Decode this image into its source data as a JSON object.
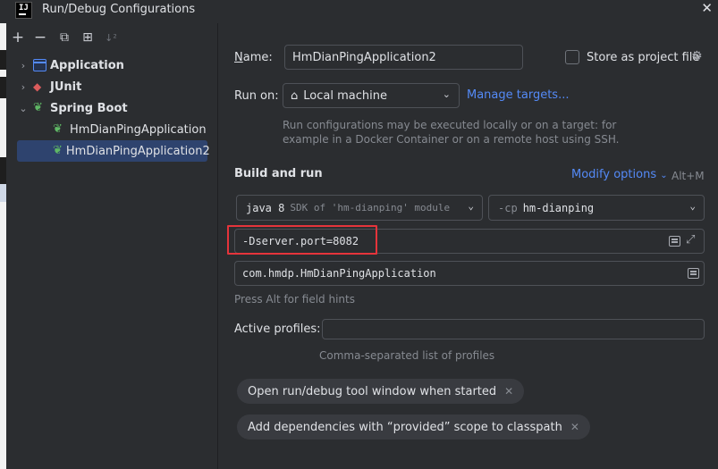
{
  "window": {
    "title": "Run/Debug Configurations",
    "logo_text": "IJ"
  },
  "toolbar": {
    "add": "+",
    "remove": "−",
    "copy": "⧉",
    "folder": "⊞",
    "sort": "↓²"
  },
  "tree": {
    "items": [
      {
        "label": "Application",
        "icon": "application-icon",
        "expanded": false
      },
      {
        "label": "JUnit",
        "icon": "junit-icon",
        "expanded": false
      },
      {
        "label": "Spring Boot",
        "icon": "spring-boot-icon",
        "expanded": true
      }
    ],
    "children": [
      {
        "label": "HmDianPingApplication",
        "icon": "spring-boot-icon"
      },
      {
        "label": "HmDianPingApplication2",
        "icon": "spring-boot-icon",
        "selected": true
      }
    ]
  },
  "form": {
    "name_label": "Name:",
    "name_value": "HmDianPingApplication2",
    "store_label": "Store as project file",
    "run_on_label": "Run on:",
    "run_on_value": "Local machine",
    "manage_targets": "Manage targets...",
    "run_on_hint_1": "Run configurations may be executed locally or on a target: for",
    "run_on_hint_2": "example in a Docker Container or on a remote host using SSH.",
    "build_and_run": "Build and run",
    "modify_options": "Modify options",
    "modify_shortcut": "Alt+M",
    "jdk_value": "java 8",
    "jdk_hint": "SDK of 'hm-dianping' module",
    "cp_prefix": "-cp",
    "cp_value": "hm-dianping",
    "vm_options": "-Dserver.port=8082",
    "main_class": "com.hmdp.HmDianPingApplication",
    "field_hint": "Press Alt for field hints",
    "profiles_label": "Active profiles:",
    "profiles_value": "",
    "profiles_hint": "Comma-separated list of profiles",
    "chips": [
      "Open run/debug tool window when started",
      "Add dependencies with “provided” scope to classpath"
    ]
  },
  "colors": {
    "accent": "#548af7",
    "highlight": "#e5343b",
    "selection": "#2e436e"
  }
}
